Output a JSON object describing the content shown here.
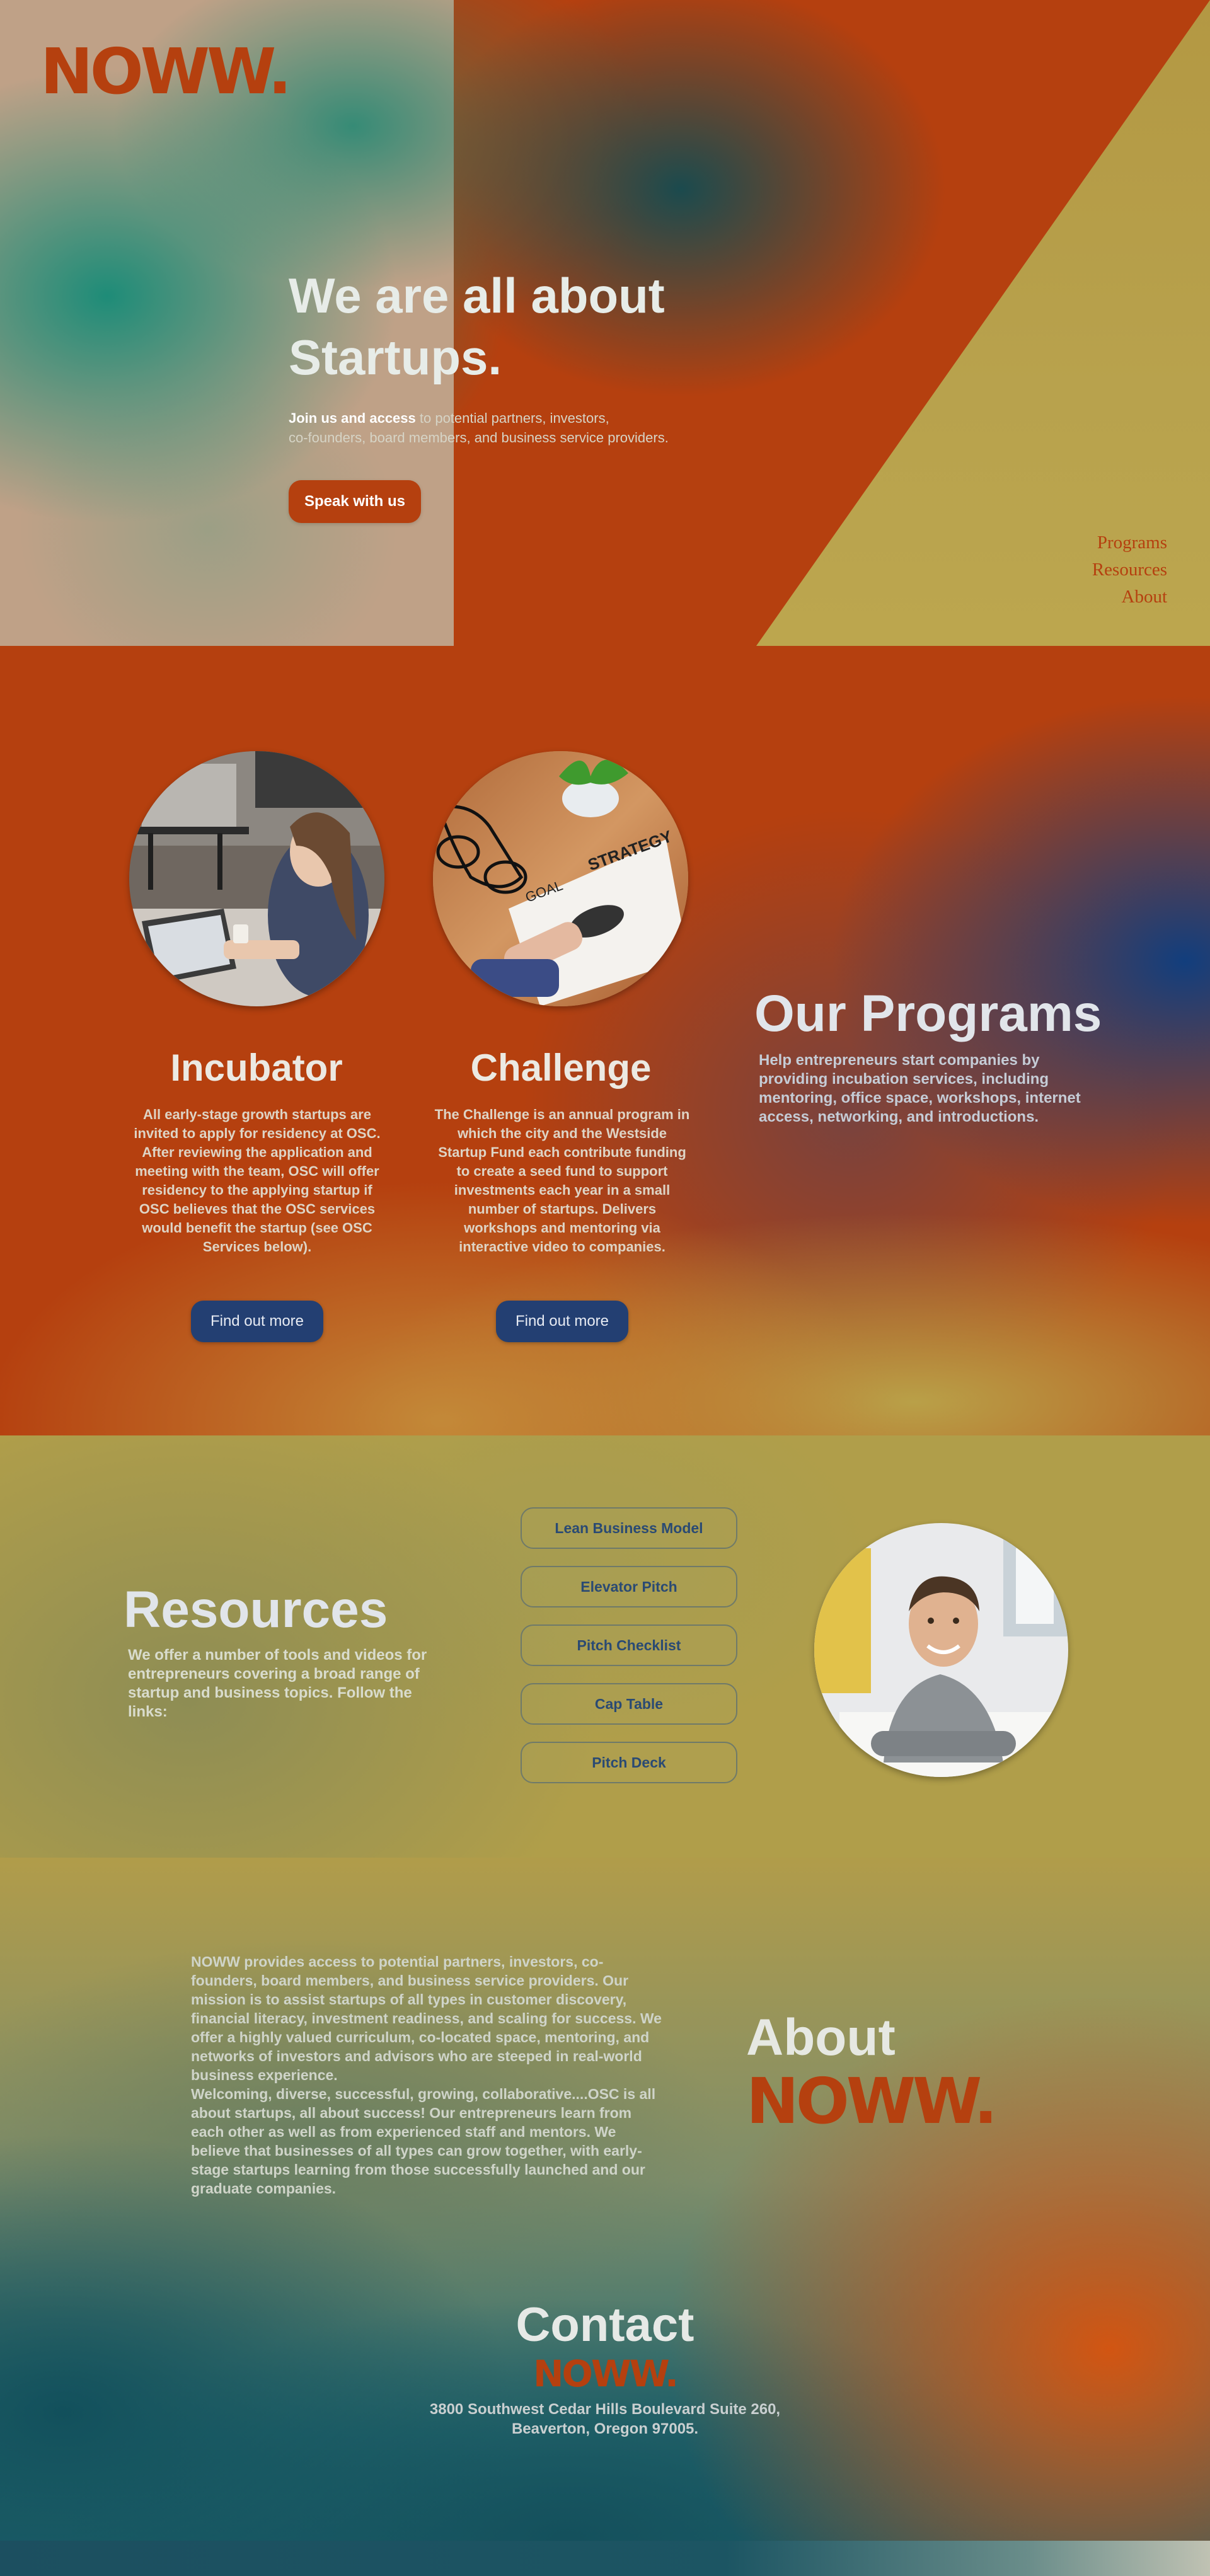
{
  "brand": {
    "logo": "NOWW.",
    "color": "#b5400f"
  },
  "hero": {
    "title_line1": "We are all about",
    "title_line2": "Startups.",
    "subtitle_bold": "Join us and access",
    "subtitle_rest_line1": " to potential partners, investors,",
    "subtitle_line2": "co-founders, board members, and business service providers.",
    "cta": "Speak with us"
  },
  "nav": {
    "items": [
      "Programs",
      "Resources",
      "About"
    ]
  },
  "programs": {
    "title": "Our Programs",
    "description": "Help entrepreneurs start companies by providing incubation services, including mentoring, office space, workshops, internet access, networking, and introductions.",
    "cards": [
      {
        "title": "Incubator",
        "text": "All early-stage growth startups are invited to apply for residency at OSC. After reviewing the application and meeting with the team, OSC will offer residency to the applying startup if OSC believes that the OSC services would benefit the startup (see OSC Services below).",
        "button": "Find out more",
        "image": "woman-with-laptop-photo"
      },
      {
        "title": "Challenge",
        "text": "The Challenge is an annual program in which the city and the Westside Startup Fund each contribute funding to create a seed fund to support investments each year in a small number of startups. Delivers workshops and mentoring via interactive video to companies.",
        "button": "Find out more",
        "image": "strategy-notebook-photo"
      }
    ],
    "accent_blue": "#233f72"
  },
  "resources": {
    "title": "Resources",
    "description": "We offer a number of tools and videos for entrepreneurs covering a broad range of startup and business topics. Follow the links:",
    "links": [
      "Lean Business Model",
      "Elevator Pitch",
      "Pitch Checklist",
      "Cap Table",
      "Pitch Deck"
    ],
    "image": "smiling-man-photo"
  },
  "about": {
    "title": "About",
    "paragraph1": "NOWW provides access to potential partners, investors, co-founders, board members, and business service providers. Our mission is to assist startups of all types in customer discovery, financial literacy, investment readiness, and scaling for success. We offer a highly valued curriculum, co-located space, mentoring, and networks of investors and advisors who are steeped in real-world business experience.",
    "paragraph2": "Welcoming, diverse, successful, growing, collaborative....OSC is all about startups, all about success! Our entrepreneurs learn from each other as well as from experienced staff and mentors. We believe that businesses of all types can grow together, with early-stage startups learning from those successfully launched and our graduate companies."
  },
  "contact": {
    "title": "Contact",
    "address_line1": "3800 Southwest Cedar Hills Boulevard Suite 260,",
    "address_line2": "Beaverton, Oregon 97005."
  }
}
